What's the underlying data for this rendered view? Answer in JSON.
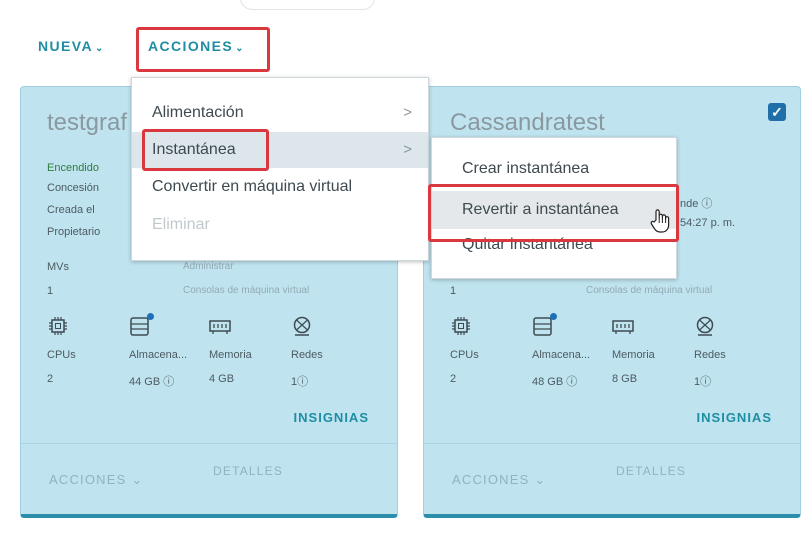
{
  "toolbar": {
    "new_label": "NUEVA",
    "actions_label": "ACCIONES",
    "chevron": "⌄"
  },
  "colors": {
    "accent": "#1f8ea3",
    "highlight": "#d9383e",
    "card_bg": "#bfe4f0",
    "status_on": "#2f7d3c"
  },
  "cards": [
    {
      "title": "testgraf",
      "status": "Encendido",
      "fields": [
        "Concesión",
        "Creada el",
        "Propietario"
      ],
      "vms_label": "MVs",
      "vms_count": "1",
      "link_manage": "Administrar",
      "link_consoles": "Consolas de máquina virtual",
      "resources": [
        {
          "icon": "cpu-icon",
          "label": "CPUs",
          "value": "2"
        },
        {
          "icon": "storage-icon",
          "label": "Almacena...",
          "value": "44 GB ⓘ"
        },
        {
          "icon": "memory-icon",
          "label": "Memoria",
          "value": "4 GB"
        },
        {
          "icon": "network-icon",
          "label": "Redes",
          "value": "1ⓘ"
        }
      ],
      "insignias": "INSIGNIAS",
      "footer_actions": "ACCIONES",
      "footer_details": "DETALLES"
    },
    {
      "title": "Cassandratest",
      "selected": true,
      "lease_tail": "nde ⓘ",
      "created_tail": "54:27 p. m.",
      "vms_count": "1",
      "link_consoles": "Consolas de máquina virtual",
      "resources": [
        {
          "icon": "cpu-icon",
          "label": "CPUs",
          "value": "2"
        },
        {
          "icon": "storage-icon",
          "label": "Almacena...",
          "value": "48 GB ⓘ"
        },
        {
          "icon": "memory-icon",
          "label": "Memoria",
          "value": "8 GB"
        },
        {
          "icon": "network-icon",
          "label": "Redes",
          "value": "1ⓘ"
        }
      ],
      "insignias": "INSIGNIAS",
      "footer_actions": "ACCIONES",
      "footer_details": "DETALLES"
    }
  ],
  "actions_menu": {
    "items": [
      {
        "label": "Alimentación",
        "submenu": true
      },
      {
        "label": "Instantánea",
        "submenu": true,
        "selected": true
      },
      {
        "label": "Convertir en máquina virtual"
      },
      {
        "label": "Eliminar",
        "disabled": true
      }
    ],
    "arrow": ">"
  },
  "snapshot_menu": {
    "items": [
      {
        "label": "Crear instantánea"
      },
      {
        "label": "Revertir a instantánea",
        "hovered": true
      },
      {
        "label": "Quitar instantánea"
      }
    ]
  }
}
